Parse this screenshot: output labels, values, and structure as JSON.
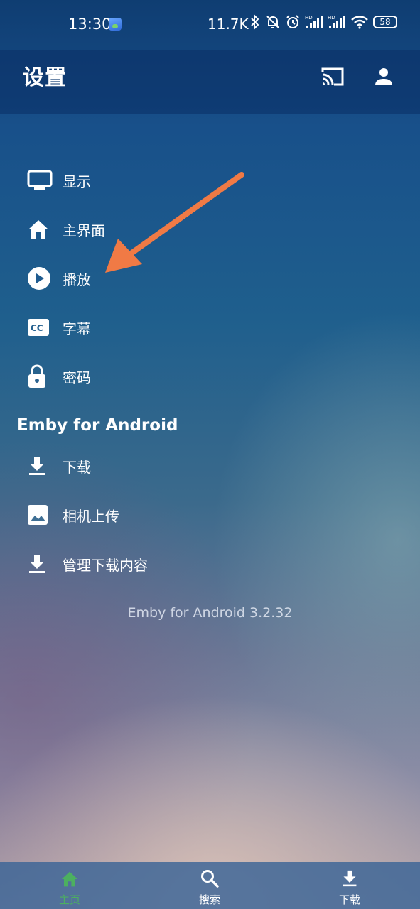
{
  "status_bar": {
    "time": "13:30",
    "net_speed": "11.7K",
    "battery": "58"
  },
  "header": {
    "title": "设置"
  },
  "menu": {
    "items": [
      {
        "label": "显示",
        "icon": "tv-icon"
      },
      {
        "label": "主界面",
        "icon": "home-icon"
      },
      {
        "label": "播放",
        "icon": "play-circle-icon"
      },
      {
        "label": "字幕",
        "icon": "closed-caption-icon"
      },
      {
        "label": "密码",
        "icon": "lock-icon"
      }
    ],
    "section_title": "Emby for Android",
    "app_items": [
      {
        "label": "下载",
        "icon": "download-icon"
      },
      {
        "label": "相机上传",
        "icon": "image-icon"
      },
      {
        "label": "管理下载内容",
        "icon": "download-icon"
      }
    ],
    "version": "Emby for Android 3.2.32"
  },
  "bottom_nav": {
    "items": [
      {
        "label": "主页",
        "icon": "home-icon",
        "active": true
      },
      {
        "label": "搜索",
        "icon": "search-icon",
        "active": false
      },
      {
        "label": "下载",
        "icon": "download-icon",
        "active": false
      }
    ]
  },
  "colors": {
    "active_tab": "#4cb060",
    "annotation_arrow": "#f07a45"
  }
}
